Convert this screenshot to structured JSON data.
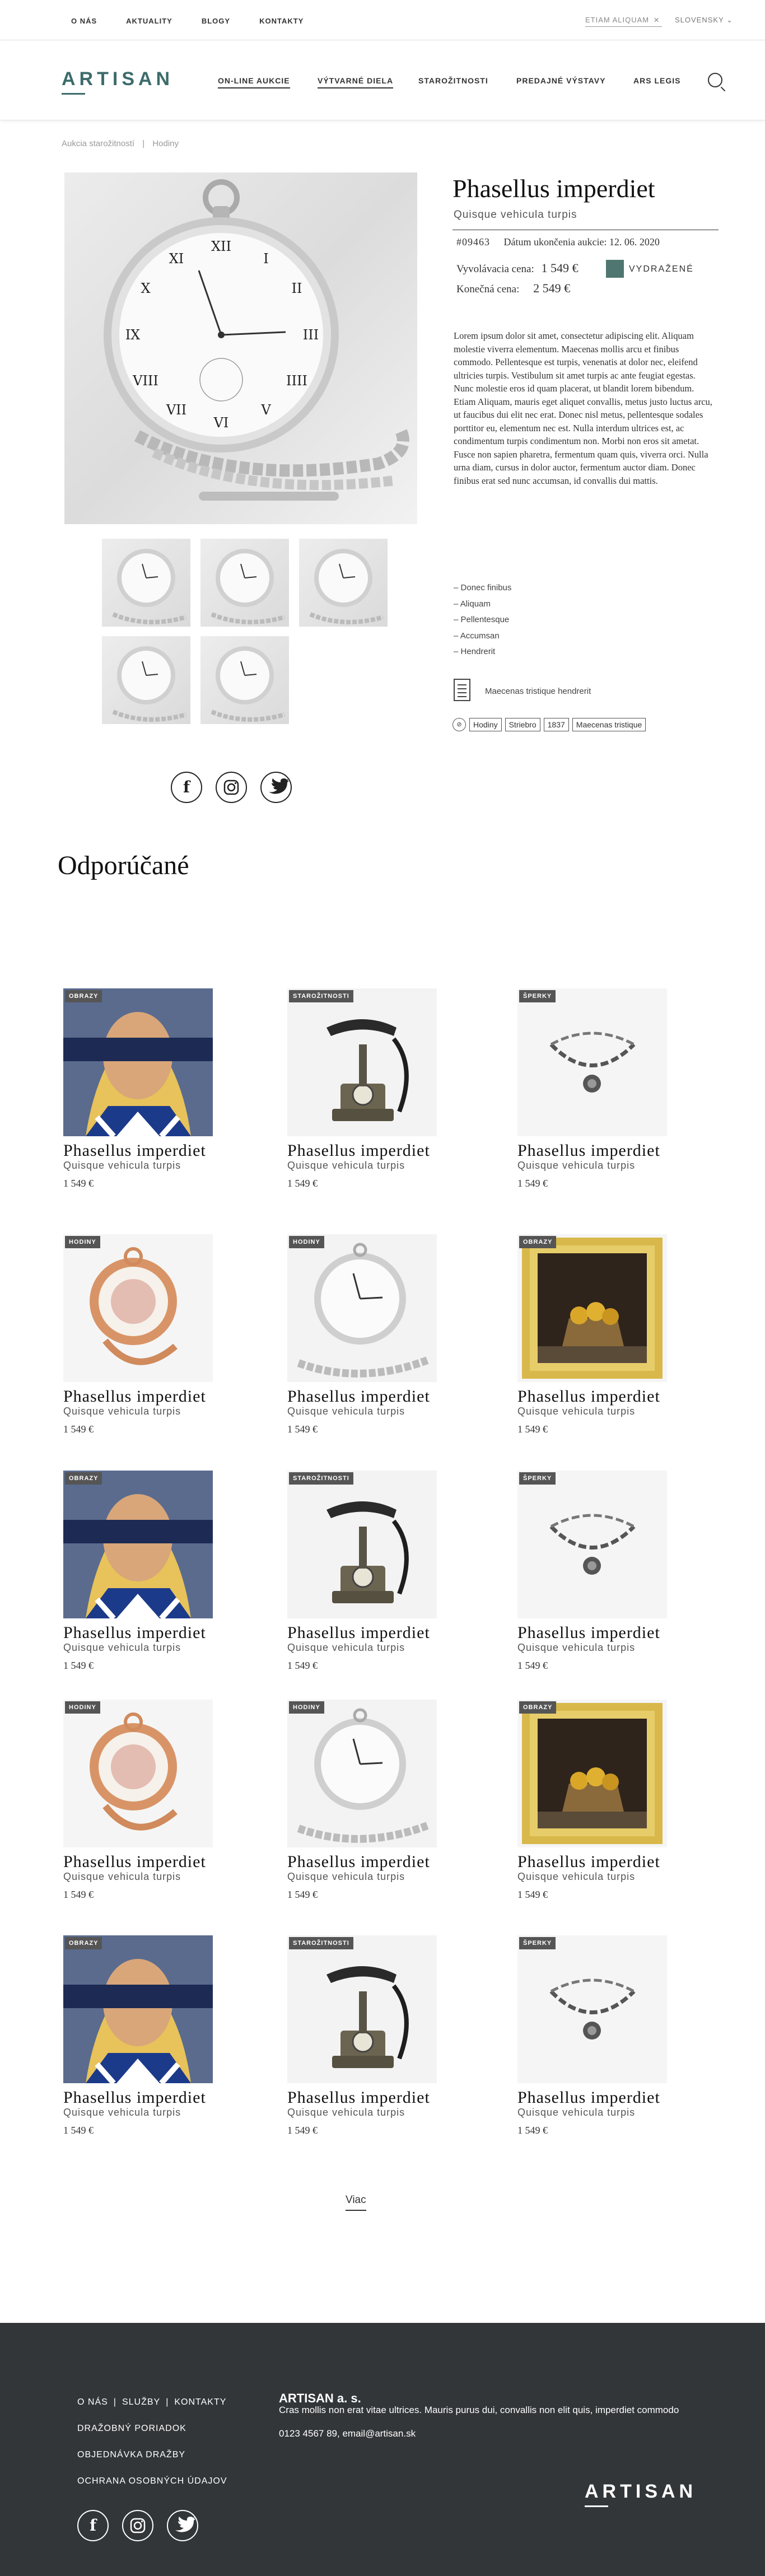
{
  "topnav": {
    "items": [
      "O NÁS",
      "AKTUALITY",
      "BLOGY",
      "KONTAKTY"
    ],
    "search_value": "ETIAM ALIQUAM",
    "language": "SLOVENSKY"
  },
  "header": {
    "logo": "ARTISAN",
    "nav": [
      "ON-LINE AUKCIE",
      "VÝTVARNÉ DIELA",
      "STAROŽITNOSTI",
      "PREDAJNÉ VÝSTAVY",
      "ARS LEGIS"
    ]
  },
  "breadcrumb": {
    "items": [
      "Aukcia starožitností",
      "Hodiny"
    ],
    "separator": "|"
  },
  "product": {
    "title": "Phasellus imperdiet",
    "subtitle": "Quisque vehicula turpis",
    "number": "#09463",
    "end_date": "Dátum ukončenia aukcie: 12. 06. 2020",
    "start_price_label": "Vyvolávacia cena:",
    "start_price": "1 549 €",
    "final_price_label": "Konečná cena:",
    "final_price": "2 549 €",
    "status": "VYDRAŽENÉ",
    "status_color": "#4f7670",
    "description": "Lorem ipsum dolor sit amet, consectetur adipiscing elit. Aliquam molestie viverra elementum. Maecenas mollis arcu et finibus commodo. Pellentesque est turpis, venenatis at dolor nec, eleifend ultricies turpis. Vestibulum sit amet turpis ac ante feugiat egestas. Nunc molestie eros id quam placerat, ut blandit lorem bibendum. Etiam Aliquam, mauris eget aliquet convallis, metus justo luctus arcu, ut faucibus dui elit nec erat. Donec nisl metus, pellentesque sodales porttitor eu, elementum nec est. Nulla interdum ultrices est, ac condimentum turpis condimentum non. Morbi non eros sit ametat. Fusce non sapien pharetra, fermentum quam quis, viverra orci. Nulla urna diam, cursus in dolor auctor, fermentum auctor diam. Donec finibus erat sed nunc accumsan, id convallis dui mattis.",
    "facts": [
      "Donec finibus",
      "Aliquam",
      "Pellentesque",
      "Accumsan",
      "Hendrerit"
    ],
    "document": "Maecenas tristique hendrerit",
    "tags": [
      "Hodiny",
      "Striebro",
      "1837",
      "Maecenas tristique"
    ]
  },
  "recommended": {
    "title": "Odporúčané",
    "cards": [
      {
        "badge": "OBRAZY",
        "kind": "painting",
        "title": "Phasellus imperdiet",
        "subtitle": "Quisque vehicula turpis",
        "price": "1 549 €"
      },
      {
        "badge": "STAROŽITNOSTI",
        "kind": "phone",
        "title": "Phasellus imperdiet",
        "subtitle": "Quisque vehicula turpis",
        "price": "1 549 €"
      },
      {
        "badge": "ŠPERKY",
        "kind": "bracelet",
        "title": "Phasellus imperdiet",
        "subtitle": "Quisque vehicula turpis",
        "price": "1 549 €"
      },
      {
        "badge": "HODINY",
        "kind": "gold-watch",
        "title": "Phasellus imperdiet",
        "subtitle": "Quisque vehicula turpis",
        "price": "1 549 €"
      },
      {
        "badge": "HODINY",
        "kind": "silver-watch",
        "title": "Phasellus imperdiet",
        "subtitle": "Quisque vehicula turpis",
        "price": "1 549 €"
      },
      {
        "badge": "OBRAZY",
        "kind": "still-life",
        "title": "Phasellus imperdiet",
        "subtitle": "Quisque vehicula turpis",
        "price": "1 549 €"
      },
      {
        "badge": "OBRAZY",
        "kind": "painting",
        "title": "Phasellus imperdiet",
        "subtitle": "Quisque vehicula turpis",
        "price": "1 549 €"
      },
      {
        "badge": "STAROŽITNOSTI",
        "kind": "phone",
        "title": "Phasellus imperdiet",
        "subtitle": "Quisque vehicula turpis",
        "price": "1 549 €"
      },
      {
        "badge": "ŠPERKY",
        "kind": "bracelet",
        "title": "Phasellus imperdiet",
        "subtitle": "Quisque vehicula turpis",
        "price": "1 549 €"
      },
      {
        "badge": "HODINY",
        "kind": "gold-watch",
        "title": "Phasellus imperdiet",
        "subtitle": "Quisque vehicula turpis",
        "price": "1 549 €"
      },
      {
        "badge": "HODINY",
        "kind": "silver-watch",
        "title": "Phasellus imperdiet",
        "subtitle": "Quisque vehicula turpis",
        "price": "1 549 €"
      },
      {
        "badge": "OBRAZY",
        "kind": "still-life",
        "title": "Phasellus imperdiet",
        "subtitle": "Quisque vehicula turpis",
        "price": "1 549 €"
      },
      {
        "badge": "OBRAZY",
        "kind": "painting",
        "title": "Phasellus imperdiet",
        "subtitle": "Quisque vehicula turpis",
        "price": "1 549 €"
      },
      {
        "badge": "STAROŽITNOSTI",
        "kind": "phone",
        "title": "Phasellus imperdiet",
        "subtitle": "Quisque vehicula turpis",
        "price": "1 549 €"
      },
      {
        "badge": "ŠPERKY",
        "kind": "bracelet",
        "title": "Phasellus imperdiet",
        "subtitle": "Quisque vehicula turpis",
        "price": "1 549 €"
      }
    ],
    "more": "Viac"
  },
  "footer": {
    "links_row1": [
      "O NÁS",
      "SLUŽBY",
      "KONTAKTY"
    ],
    "links": [
      "DRAŽOBNÝ PORIADOK",
      "OBJEDNÁVKA DRAŽBY",
      "OCHRANA OSOBNÝCH ÚDAJOV"
    ],
    "company": "ARTISAN a. s.",
    "text": "Cras mollis non erat vitae ultrices. Mauris purus dui, convallis non elit quis, imperdiet commodo",
    "contact": "0123 4567 89, email@artisan.sk",
    "logo": "ARTISAN",
    "background": "#333639"
  },
  "icons": [
    "facebook-icon",
    "instagram-icon",
    "twitter-icon",
    "search-icon",
    "close-icon",
    "chevron-down-icon",
    "document-icon",
    "tag-icon"
  ]
}
